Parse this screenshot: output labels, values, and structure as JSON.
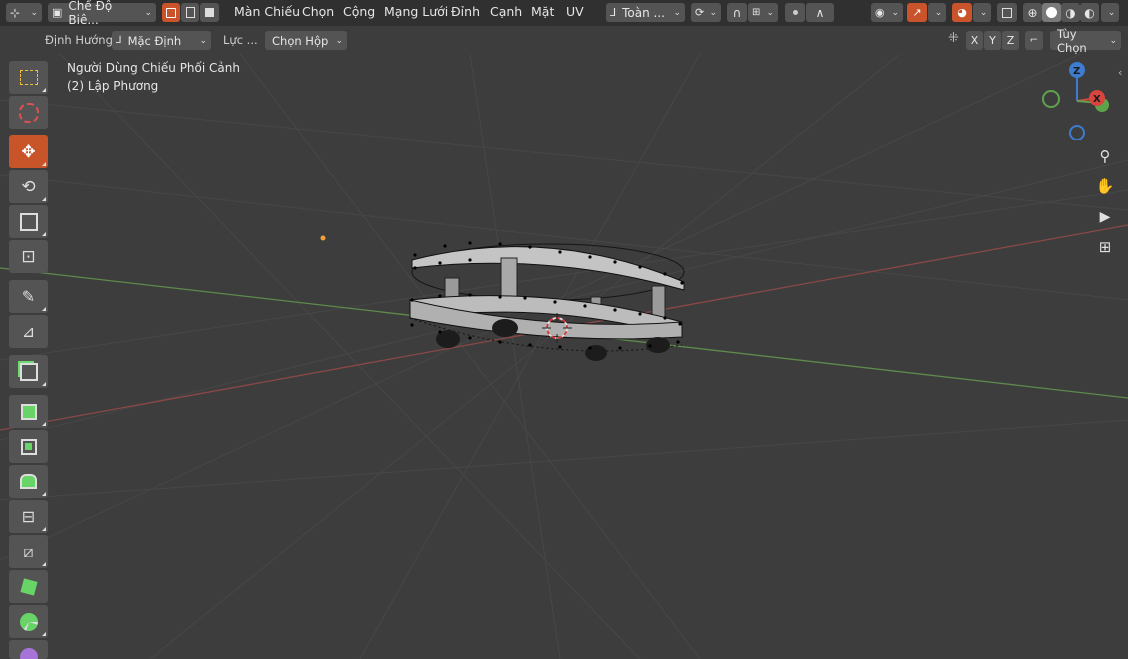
{
  "header": {
    "mode_label": "Chế Độ Biê...",
    "menus": [
      "Màn Chiếu",
      "Chọn",
      "Cộng",
      "Mạng Lưới",
      "Đỉnh",
      "Cạnh",
      "Mặt",
      "UV"
    ],
    "transform_orientation_label": "Toàn ..."
  },
  "subheader": {
    "orientation_label": "Định Hướng:",
    "orientation_value": "Mặc Định",
    "drag_label": "Lực ...",
    "drag_value": "Chọn Hộp",
    "axis_x": "X",
    "axis_y": "Y",
    "axis_z": "Z",
    "options_label": "Tùy Chọn"
  },
  "viewport": {
    "view_name": "Người Dùng Chiếu Phối Cảnh",
    "object_name": "(2) Lập Phương"
  },
  "gizmo": {
    "z_label": "Z",
    "x_label": "X"
  },
  "colors": {
    "accent": "#c8542a",
    "axis_x": "#d8443e",
    "axis_y": "#5ea34a",
    "axis_z": "#3d7ccf"
  },
  "icons": {
    "toolbar": [
      "select-box-icon",
      "cursor-icon",
      "move-icon",
      "rotate-icon",
      "scale-icon",
      "transform-icon",
      "annotate-icon",
      "measure-icon",
      "add-cube-icon",
      "extrude-icon",
      "inset-icon",
      "bevel-icon",
      "loop-cut-icon",
      "knife-icon",
      "poly-build-icon",
      "spin-icon",
      "smooth-icon"
    ],
    "nav": [
      "zoom-icon",
      "pan-hand-icon",
      "camera-icon",
      "grid-ortho-icon"
    ]
  }
}
